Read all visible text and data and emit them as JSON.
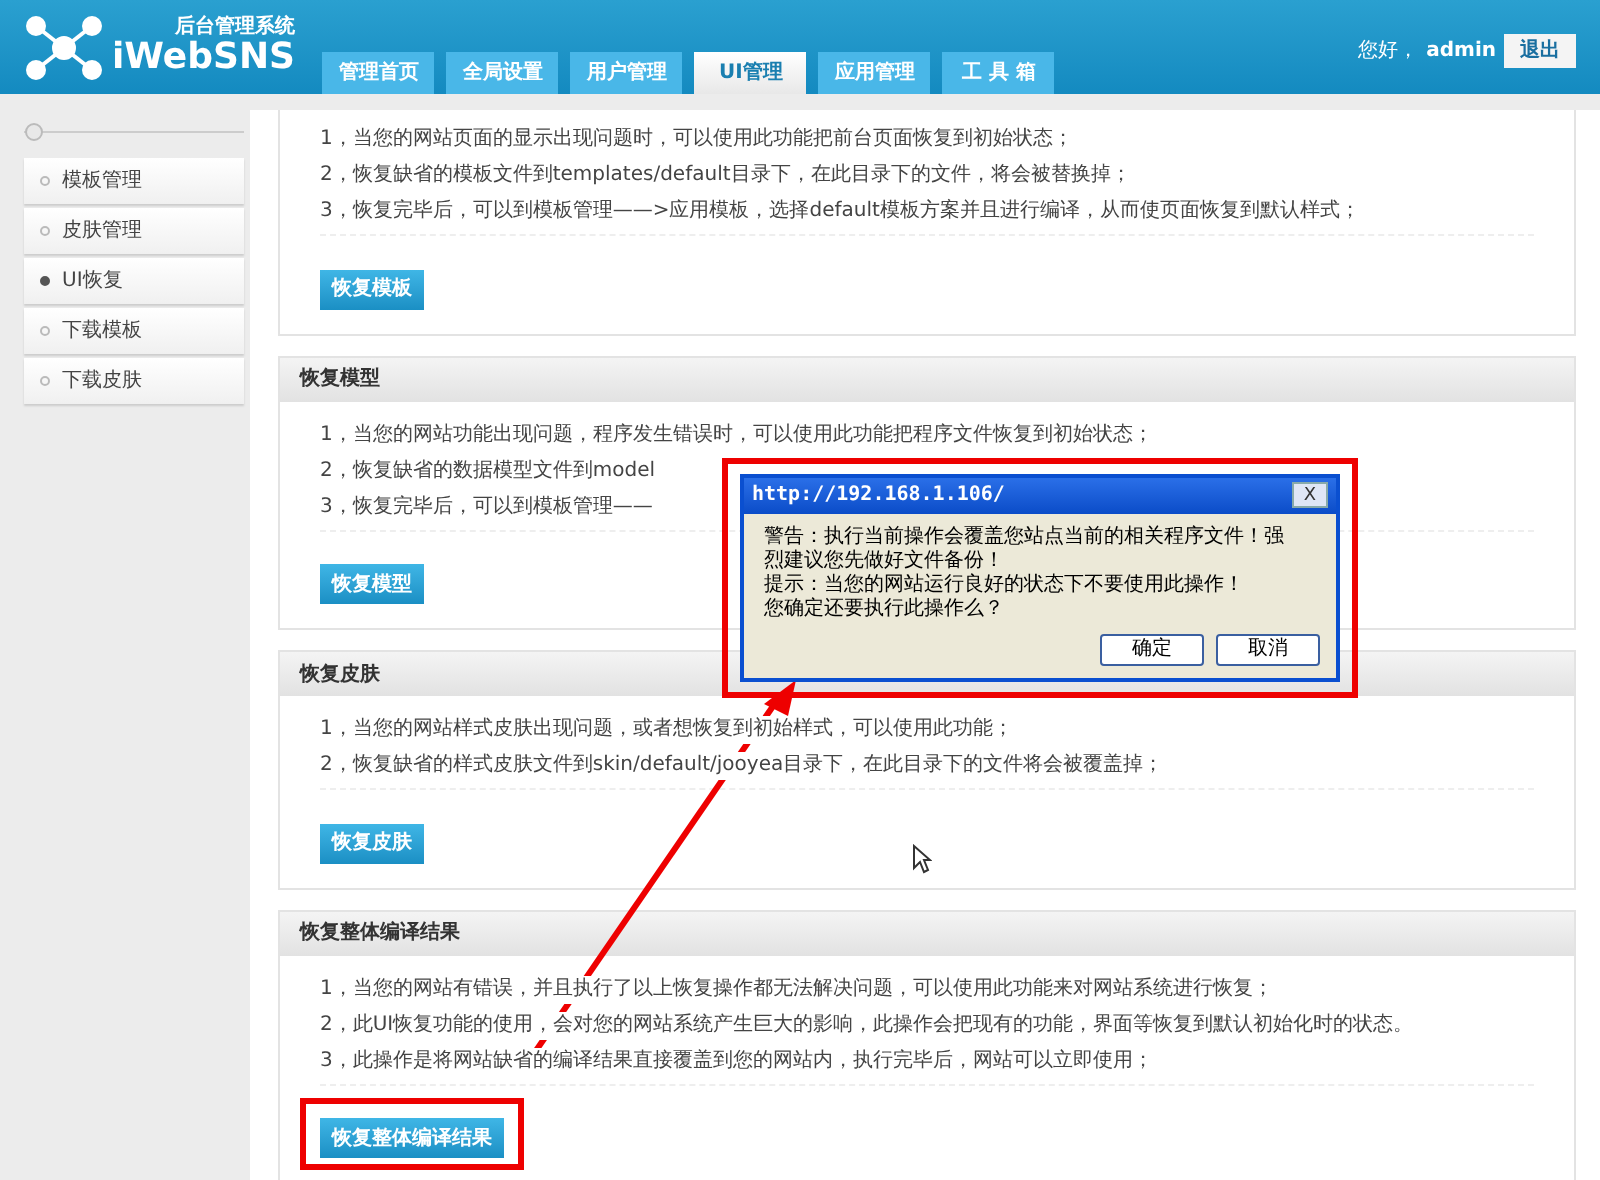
{
  "header": {
    "logo_subtitle": "后台管理系统",
    "logo_title": "iWebSNS",
    "greeting": "您好，",
    "user": "admin",
    "logout": "退出",
    "tabs": [
      {
        "label": "管理首页",
        "selected": false
      },
      {
        "label": "全局设置",
        "selected": false
      },
      {
        "label": "用户管理",
        "selected": false
      },
      {
        "label": "UI管理",
        "selected": true
      },
      {
        "label": "应用管理",
        "selected": false
      },
      {
        "label": "工 具 箱",
        "selected": false
      }
    ]
  },
  "sidebar": {
    "items": [
      {
        "label": "模板管理",
        "selected": false
      },
      {
        "label": "皮肤管理",
        "selected": false
      },
      {
        "label": "UI恢复",
        "selected": true
      },
      {
        "label": "下载模板",
        "selected": false
      },
      {
        "label": "下载皮肤",
        "selected": false
      }
    ]
  },
  "sections": [
    {
      "lines": [
        "1，当您的网站页面的显示出现问题时，可以使用此功能把前台页面恢复到初始状态；",
        "2，恢复缺省的模板文件到templates/default目录下，在此目录下的文件，将会被替换掉；",
        "3，恢复完毕后，可以到模板管理——>应用模板，选择default模板方案并且进行编译，从而使页面恢复到默认样式；"
      ],
      "button": "恢复模板",
      "highlighted": false
    },
    {
      "title": "恢复模型",
      "lines": [
        "1，当您的网站功能出现问题，程序发生错误时，可以使用此功能把程序文件恢复到初始状态；",
        "2，恢复缺省的数据模型文件到model",
        "3，恢复完毕后，可以到模板管理——"
      ],
      "button": "恢复模型",
      "highlighted": false
    },
    {
      "title": "恢复皮肤",
      "lines": [
        "1，当您的网站样式皮肤出现问题，或者想恢复到初始样式，可以使用此功能；",
        "2，恢复缺省的样式皮肤文件到skin/default/jooyea目录下，在此目录下的文件将会被覆盖掉；"
      ],
      "button": "恢复皮肤",
      "highlighted": false
    },
    {
      "title": "恢复整体编译结果",
      "lines": [
        "1，当您的网站有错误，并且执行了以上恢复操作都无法解决问题，可以使用此功能来对网站系统进行恢复；",
        "2，此UI恢复功能的使用，会对您的网站系统产生巨大的影响，此操作会把现有的功能，界面等恢复到默认初始化时的状态。",
        "3，此操作是将网站缺省的编译结果直接覆盖到您的网站内，执行完毕后，网站可以立即使用；"
      ],
      "button": "恢复整体编译结果",
      "highlighted": true
    }
  ],
  "dialog": {
    "title": "http://192.168.1.106/",
    "close": "X",
    "message": [
      "警告：执行当前操作会覆盖您站点当前的相关程序文件！强",
      "烈建议您先做好文件备份！",
      "提示：当您的网站运行良好的状态下不要使用此操作！",
      "您确定还要执行此操作么？"
    ],
    "buttons": [
      "确定",
      "取消"
    ]
  }
}
